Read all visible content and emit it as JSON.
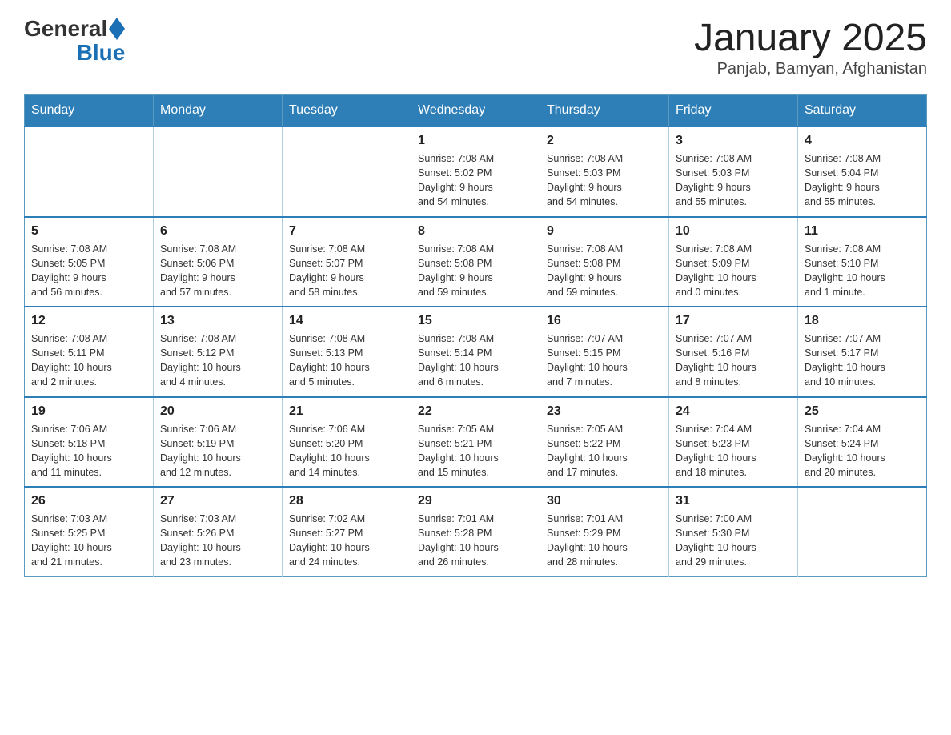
{
  "logo": {
    "text_general": "General",
    "text_blue": "Blue"
  },
  "title": "January 2025",
  "subtitle": "Panjab, Bamyan, Afghanistan",
  "days_of_week": [
    "Sunday",
    "Monday",
    "Tuesday",
    "Wednesday",
    "Thursday",
    "Friday",
    "Saturday"
  ],
  "weeks": [
    [
      {
        "day": "",
        "info": ""
      },
      {
        "day": "",
        "info": ""
      },
      {
        "day": "",
        "info": ""
      },
      {
        "day": "1",
        "info": "Sunrise: 7:08 AM\nSunset: 5:02 PM\nDaylight: 9 hours\nand 54 minutes."
      },
      {
        "day": "2",
        "info": "Sunrise: 7:08 AM\nSunset: 5:03 PM\nDaylight: 9 hours\nand 54 minutes."
      },
      {
        "day": "3",
        "info": "Sunrise: 7:08 AM\nSunset: 5:03 PM\nDaylight: 9 hours\nand 55 minutes."
      },
      {
        "day": "4",
        "info": "Sunrise: 7:08 AM\nSunset: 5:04 PM\nDaylight: 9 hours\nand 55 minutes."
      }
    ],
    [
      {
        "day": "5",
        "info": "Sunrise: 7:08 AM\nSunset: 5:05 PM\nDaylight: 9 hours\nand 56 minutes."
      },
      {
        "day": "6",
        "info": "Sunrise: 7:08 AM\nSunset: 5:06 PM\nDaylight: 9 hours\nand 57 minutes."
      },
      {
        "day": "7",
        "info": "Sunrise: 7:08 AM\nSunset: 5:07 PM\nDaylight: 9 hours\nand 58 minutes."
      },
      {
        "day": "8",
        "info": "Sunrise: 7:08 AM\nSunset: 5:08 PM\nDaylight: 9 hours\nand 59 minutes."
      },
      {
        "day": "9",
        "info": "Sunrise: 7:08 AM\nSunset: 5:08 PM\nDaylight: 9 hours\nand 59 minutes."
      },
      {
        "day": "10",
        "info": "Sunrise: 7:08 AM\nSunset: 5:09 PM\nDaylight: 10 hours\nand 0 minutes."
      },
      {
        "day": "11",
        "info": "Sunrise: 7:08 AM\nSunset: 5:10 PM\nDaylight: 10 hours\nand 1 minute."
      }
    ],
    [
      {
        "day": "12",
        "info": "Sunrise: 7:08 AM\nSunset: 5:11 PM\nDaylight: 10 hours\nand 2 minutes."
      },
      {
        "day": "13",
        "info": "Sunrise: 7:08 AM\nSunset: 5:12 PM\nDaylight: 10 hours\nand 4 minutes."
      },
      {
        "day": "14",
        "info": "Sunrise: 7:08 AM\nSunset: 5:13 PM\nDaylight: 10 hours\nand 5 minutes."
      },
      {
        "day": "15",
        "info": "Sunrise: 7:08 AM\nSunset: 5:14 PM\nDaylight: 10 hours\nand 6 minutes."
      },
      {
        "day": "16",
        "info": "Sunrise: 7:07 AM\nSunset: 5:15 PM\nDaylight: 10 hours\nand 7 minutes."
      },
      {
        "day": "17",
        "info": "Sunrise: 7:07 AM\nSunset: 5:16 PM\nDaylight: 10 hours\nand 8 minutes."
      },
      {
        "day": "18",
        "info": "Sunrise: 7:07 AM\nSunset: 5:17 PM\nDaylight: 10 hours\nand 10 minutes."
      }
    ],
    [
      {
        "day": "19",
        "info": "Sunrise: 7:06 AM\nSunset: 5:18 PM\nDaylight: 10 hours\nand 11 minutes."
      },
      {
        "day": "20",
        "info": "Sunrise: 7:06 AM\nSunset: 5:19 PM\nDaylight: 10 hours\nand 12 minutes."
      },
      {
        "day": "21",
        "info": "Sunrise: 7:06 AM\nSunset: 5:20 PM\nDaylight: 10 hours\nand 14 minutes."
      },
      {
        "day": "22",
        "info": "Sunrise: 7:05 AM\nSunset: 5:21 PM\nDaylight: 10 hours\nand 15 minutes."
      },
      {
        "day": "23",
        "info": "Sunrise: 7:05 AM\nSunset: 5:22 PM\nDaylight: 10 hours\nand 17 minutes."
      },
      {
        "day": "24",
        "info": "Sunrise: 7:04 AM\nSunset: 5:23 PM\nDaylight: 10 hours\nand 18 minutes."
      },
      {
        "day": "25",
        "info": "Sunrise: 7:04 AM\nSunset: 5:24 PM\nDaylight: 10 hours\nand 20 minutes."
      }
    ],
    [
      {
        "day": "26",
        "info": "Sunrise: 7:03 AM\nSunset: 5:25 PM\nDaylight: 10 hours\nand 21 minutes."
      },
      {
        "day": "27",
        "info": "Sunrise: 7:03 AM\nSunset: 5:26 PM\nDaylight: 10 hours\nand 23 minutes."
      },
      {
        "day": "28",
        "info": "Sunrise: 7:02 AM\nSunset: 5:27 PM\nDaylight: 10 hours\nand 24 minutes."
      },
      {
        "day": "29",
        "info": "Sunrise: 7:01 AM\nSunset: 5:28 PM\nDaylight: 10 hours\nand 26 minutes."
      },
      {
        "day": "30",
        "info": "Sunrise: 7:01 AM\nSunset: 5:29 PM\nDaylight: 10 hours\nand 28 minutes."
      },
      {
        "day": "31",
        "info": "Sunrise: 7:00 AM\nSunset: 5:30 PM\nDaylight: 10 hours\nand 29 minutes."
      },
      {
        "day": "",
        "info": ""
      }
    ]
  ]
}
